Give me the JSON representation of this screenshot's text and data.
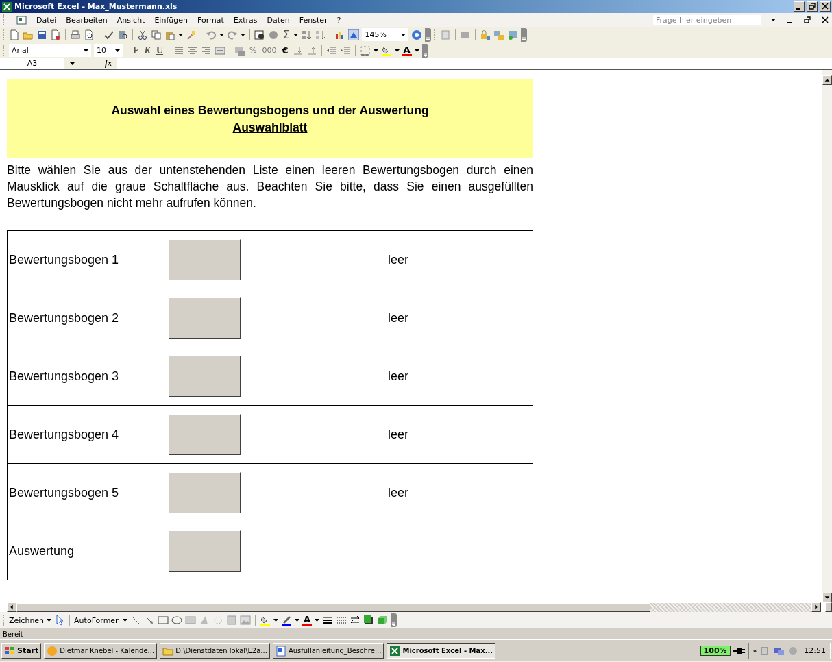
{
  "window": {
    "title": "Microsoft Excel - Max_Mustermann.xls"
  },
  "menu": {
    "items": [
      "Datei",
      "Bearbeiten",
      "Ansicht",
      "Einfügen",
      "Format",
      "Extras",
      "Daten",
      "Fenster",
      "?"
    ],
    "help_placeholder": "Frage hier eingeben"
  },
  "standard_toolbar": {
    "sum_symbol": "Σ",
    "zoom": "145%"
  },
  "formatting_toolbar": {
    "font": "Arial",
    "size": "10",
    "bold": "F",
    "italic": "K",
    "underline": "U",
    "percent": "%",
    "thousands": "000",
    "euro": "€",
    "font_color": "A"
  },
  "formula_bar": {
    "cell_ref": "A3",
    "fx_label": "fx"
  },
  "sheet": {
    "title": "Auswahl eines Bewertungsbogens und der Auswertung",
    "subtitle": "Auswahlblatt",
    "instructions": "Bitte wählen Sie aus der untenstehenden Liste einen leeren Bewertungsbogen durch einen Mausklick auf die graue Schaltfläche aus. Beachten Sie bitte, dass Sie einen ausgefüllten Bewertungsbogen nicht mehr aufrufen können.",
    "rows": [
      {
        "label": "Bewertungsbogen 1",
        "status": "leer"
      },
      {
        "label": "Bewertungsbogen 2",
        "status": "leer"
      },
      {
        "label": "Bewertungsbogen 3",
        "status": "leer"
      },
      {
        "label": "Bewertungsbogen 4",
        "status": "leer"
      },
      {
        "label": "Bewertungsbogen 5",
        "status": "leer"
      },
      {
        "label": "Auswertung"
      }
    ]
  },
  "drawing_toolbar": {
    "draw_menu": "Zeichnen",
    "autoshapes": "AutoFormen",
    "font_color": "A"
  },
  "status_bar": {
    "text": "Bereit"
  },
  "taskbar": {
    "start": "Start",
    "tasks": [
      {
        "label": "Dietmar Knebel - Kalende...",
        "selected": false
      },
      {
        "label": "D:\\Dienstdaten lokal\\E2a...",
        "selected": false
      },
      {
        "label": "Ausfüllanleitung_Beschre...",
        "selected": false
      },
      {
        "label": "Microsoft Excel - Max...",
        "selected": true
      }
    ],
    "battery": "100%",
    "tray_expand": "«",
    "clock": "12:51"
  }
}
